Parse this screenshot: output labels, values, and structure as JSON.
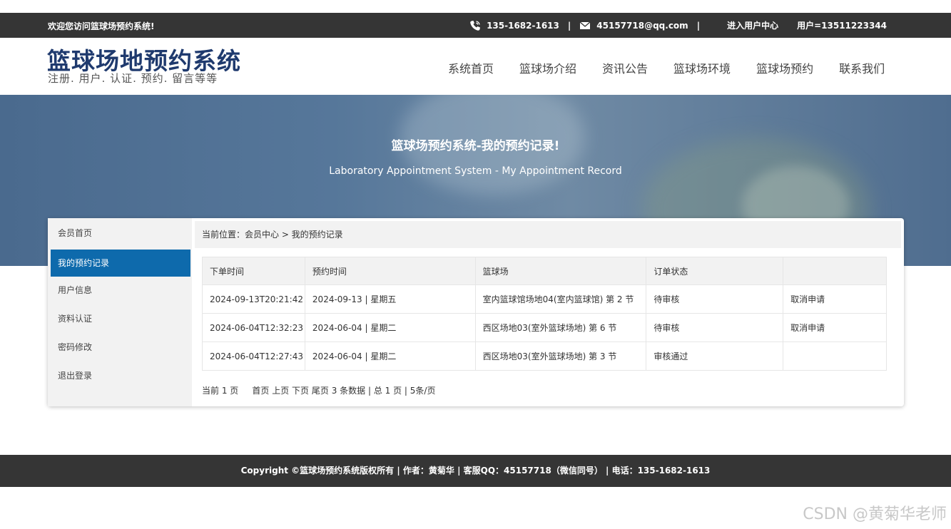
{
  "topbar": {
    "welcome": "欢迎您访问篮球场预约系统!",
    "phone": "135-1682-1613",
    "email": "45157718@qq.com",
    "separator": "|",
    "user_center": "进入用户中心",
    "user": "用户=13511223344",
    "icons": {
      "phone": "phone-icon",
      "email": "mail-icon"
    }
  },
  "header": {
    "title": "篮球场地预约系统",
    "subtitle": "注册. 用户. 认证. 预约. 留言等等",
    "nav": [
      "系统首页",
      "篮球场介绍",
      "资讯公告",
      "篮球场环境",
      "篮球场预约",
      "联系我们"
    ]
  },
  "banner": {
    "title": "篮球场预约系统-我的预约记录!",
    "subtitle": "Laboratory Appointment System - My Appointment Record"
  },
  "sidebar": {
    "items": [
      "会员首页",
      "我的预约记录",
      "用户信息",
      "资料认证",
      "密码修改",
      "退出登录"
    ],
    "active_index": 1
  },
  "breadcrumb": "当前位置：会员中心 > 我的预约记录",
  "table": {
    "headers": [
      "下单时间",
      "预约时间",
      "篮球场",
      "订单状态",
      ""
    ],
    "rows": [
      [
        "2024-09-13T20:21:42",
        "2024-09-13 | 星期五",
        "室内篮球馆场地04(室内篮球馆) 第 2 节",
        "待审核",
        "取消申请"
      ],
      [
        "2024-06-04T12:32:23",
        "2024-06-04 | 星期二",
        "西区场地03(室外篮球场地) 第 6 节",
        "待审核",
        "取消申请"
      ],
      [
        "2024-06-04T12:27:43",
        "2024-06-04 | 星期二",
        "西区场地03(室外篮球场地) 第 3 节",
        "审核通过",
        ""
      ]
    ]
  },
  "pager": {
    "current": "当前 1 页",
    "first": "首页",
    "prev": "上页",
    "next": "下页",
    "last": "尾页",
    "summary": "3 条数据 | 总 1 页 | 5条/页"
  },
  "footer": "Copyright ©篮球场预约系统版权所有 | 作者：黄菊华 | 客服QQ：45157718（微信同号） | 电话：135-1682-1613",
  "watermark": "CSDN @黄菊华老师",
  "colors": {
    "accent": "#0e6aac",
    "topbar": "#353535",
    "pending": "#e02020",
    "title": "#1f3a6e"
  }
}
